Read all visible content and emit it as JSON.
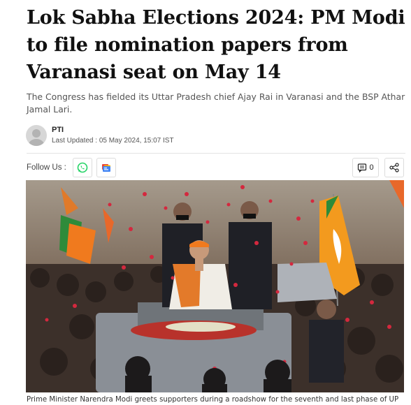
{
  "article": {
    "headline": "Lok Sabha Elections 2024: PM Modi to file nomination papers from Varanasi seat on May 14",
    "subhead": "The Congress has fielded its Uttar Pradesh chief Ajay Rai in Varanasi and the BSP Athar Jamal Lari.",
    "author": "PTI",
    "updated": "Last Updated : 05 May 2024, 15:07 IST"
  },
  "share_bar": {
    "follow_label": "Follow Us :",
    "comment_count": "0",
    "icons": [
      "whatsapp-icon",
      "google-news-icon",
      "comment-icon",
      "share-icon"
    ],
    "colors": {
      "whatsapp": "#25d366",
      "google_news_blue": "#4285f4"
    }
  },
  "image": {
    "caption": "Prime Minister Narendra Modi greets supporters during a roadshow for the seventh and last phase of UP"
  },
  "colors": {
    "headline": "#111111",
    "subhead": "#555555",
    "border": "#dcdcdc"
  }
}
